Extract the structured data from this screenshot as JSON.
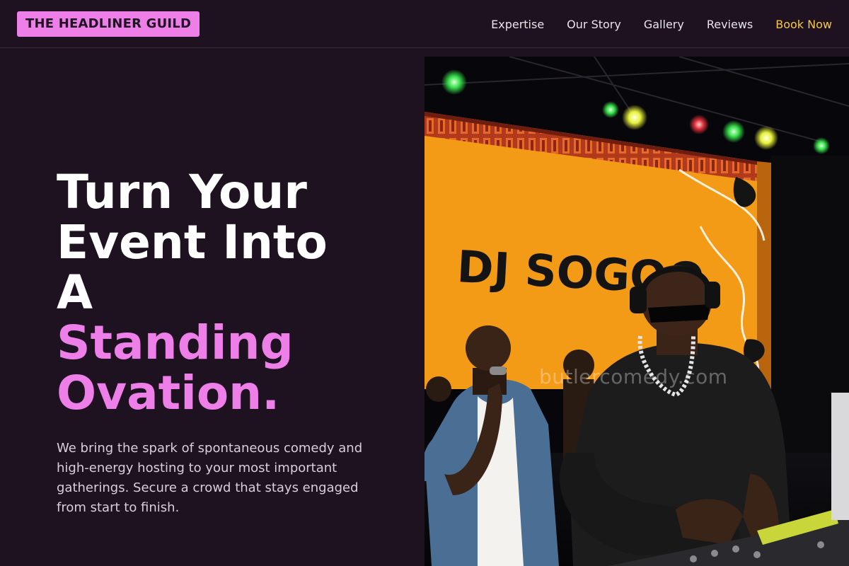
{
  "brand": {
    "name": "THE HEADLINER GUILD"
  },
  "nav": {
    "items": [
      {
        "label": "Expertise"
      },
      {
        "label": "Our Story"
      },
      {
        "label": "Gallery"
      },
      {
        "label": "Reviews"
      }
    ],
    "cta": {
      "label": "Book Now"
    }
  },
  "hero": {
    "headline_lines": [
      "Turn Your",
      "Event Into",
      "A"
    ],
    "headline_accent_lines": [
      "Standing",
      "Ovation."
    ],
    "subtitle": "We bring the spark of spontaneous comedy and high-energy hosting to your most important gatherings. Secure a crowd that stays engaged from start to finish.",
    "image": {
      "screen_text": "DJ SOGOO",
      "watermark": "butlercomedy.com"
    }
  },
  "colors": {
    "background": "#1e1120",
    "accent": "#ee7fe9",
    "cta": "#f5c84b",
    "text": "#ffffff"
  }
}
